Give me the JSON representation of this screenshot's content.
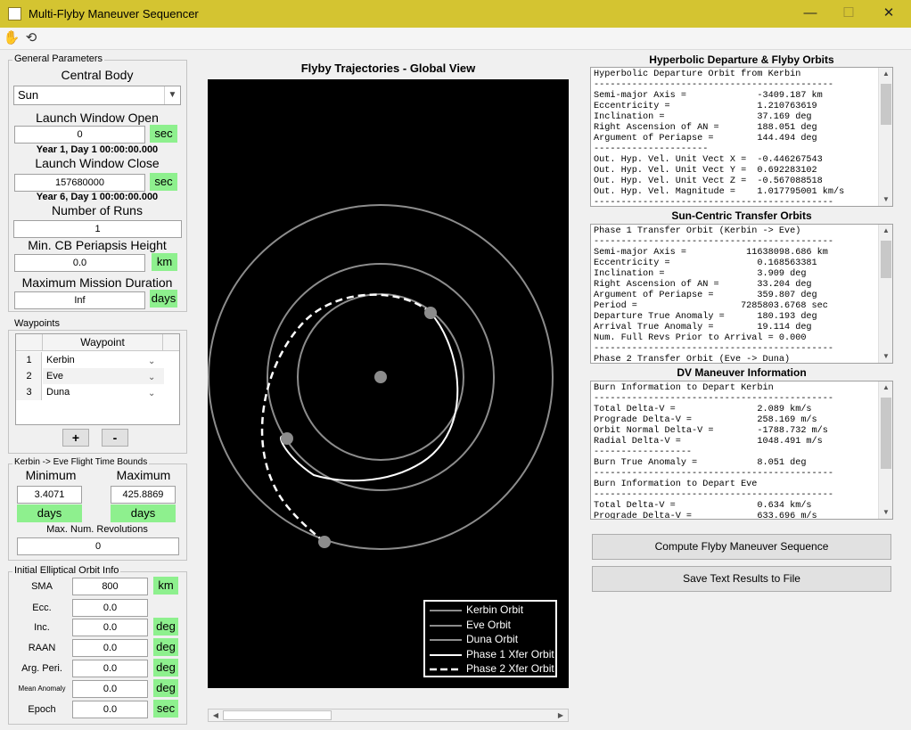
{
  "window": {
    "title": "Multi-Flyby Maneuver Sequencer",
    "minimize": "—",
    "maximize": "☐",
    "close": "✕"
  },
  "toolbar": {
    "pan_icon": "✋",
    "rotate_icon": "⟲"
  },
  "general": {
    "title": "General Parameters",
    "central_body_label": "Central Body",
    "central_body_value": "Sun",
    "launch_open_label": "Launch Window Open",
    "launch_open_value": "0",
    "launch_open_unit": "sec",
    "launch_open_date": "Year 1, Day 1 00:00:00.000",
    "launch_close_label": "Launch Window Close",
    "launch_close_value": "157680000",
    "launch_close_unit": "sec",
    "launch_close_date": "Year 6, Day 1 00:00:00.000",
    "num_runs_label": "Number of Runs",
    "num_runs_value": "1",
    "min_peri_label": "Min. CB Periapsis Height",
    "min_peri_value": "0.0",
    "min_peri_unit": "km",
    "max_dur_label": "Maximum Mission Duration",
    "max_dur_value": "Inf",
    "max_dur_unit": "days"
  },
  "waypoints": {
    "title": "Waypoints",
    "header": "Waypoint",
    "rows": [
      {
        "num": "1",
        "name": "Kerbin"
      },
      {
        "num": "2",
        "name": "Eve"
      },
      {
        "num": "3",
        "name": "Duna"
      }
    ],
    "add": "+",
    "remove": "-"
  },
  "bounds": {
    "title": "Kerbin -> Eve Flight Time Bounds",
    "min_label": "Minimum",
    "max_label": "Maximum",
    "min_value": "3.4071",
    "max_value": "425.8869",
    "min_unit": "days",
    "max_unit": "days",
    "revs_label": "Max. Num. Revolutions",
    "revs_value": "0"
  },
  "orbit": {
    "title": "Initial Elliptical Orbit Info",
    "rows": [
      {
        "label": "SMA",
        "value": "800",
        "unit": "km"
      },
      {
        "label": "Ecc.",
        "value": "0.0",
        "unit": ""
      },
      {
        "label": "Inc.",
        "value": "0.0",
        "unit": "deg"
      },
      {
        "label": "RAAN",
        "value": "0.0",
        "unit": "deg"
      },
      {
        "label": "Arg. Peri.",
        "value": "0.0",
        "unit": "deg"
      },
      {
        "label": "Mean Anomaly",
        "value": "0.0",
        "unit": "deg"
      },
      {
        "label": "Epoch",
        "value": "0.0",
        "unit": "sec"
      }
    ]
  },
  "plot": {
    "title": "Flyby Trajectories - Global View",
    "legend": [
      "Kerbin Orbit",
      "Eve Orbit",
      "Duna Orbit",
      "Phase 1 Xfer Orbit",
      "Phase 2 Xfer Orbit"
    ],
    "scroll_left": "◀",
    "scroll_right": "▶"
  },
  "results": {
    "hyp_title": "Hyperbolic Departure & Flyby Orbits",
    "hyp_text": "Hyperbolic Departure Orbit from Kerbin\n--------------------------------------------\nSemi-major Axis =             -3409.187 km\nEccentricity =                1.210763619\nInclination =                 37.169 deg\nRight Ascension of AN =       188.051 deg\nArgument of Periapse =        144.494 deg\n---------------------\nOut. Hyp. Vel. Unit Vect X =  -0.446267543\nOut. Hyp. Vel. Unit Vect Y =  0.692283102\nOut. Hyp. Vel. Unit Vect Z =  -0.567088518\nOut. Hyp. Vel. Magnitude =    1.017795001 km/s\n--------------------------------------------",
    "xfer_title": "Sun-Centric Transfer Orbits",
    "xfer_text": "Phase 1 Transfer Orbit (Kerbin -> Eve)\n--------------------------------------------\nSemi-major Axis =           11638098.686 km\nEccentricity =                0.168563381\nInclination =                 3.909 deg\nRight Ascension of AN =       33.204 deg\nArgument of Periapse =        359.807 deg\nPeriod =                   7285803.6768 sec\nDeparture True Anomaly =      180.193 deg\nArrival True Anomaly =        19.114 deg\nNum. Full Revs Prior to Arrival = 0.000\n--------------------------------------------\nPhase 2 Transfer Orbit (Eve -> Duna)",
    "dv_title": "DV Maneuver Information",
    "dv_text": "Burn Information to Depart Kerbin\n--------------------------------------------\nTotal Delta-V =               2.089 km/s\nPrograde Delta-V =            258.169 m/s\nOrbit Normal Delta-V =        -1788.732 m/s\nRadial Delta-V =              1048.491 m/s\n------------------\nBurn True Anomaly =           8.051 deg\n--------------------------------------------\nBurn Information to Depart Eve\n--------------------------------------------\nTotal Delta-V =               0.634 km/s\nPrograde Delta-V =            633.696 m/s",
    "compute_button": "Compute Flyby Maneuver Sequence",
    "save_button": "Save Text Results to File"
  }
}
